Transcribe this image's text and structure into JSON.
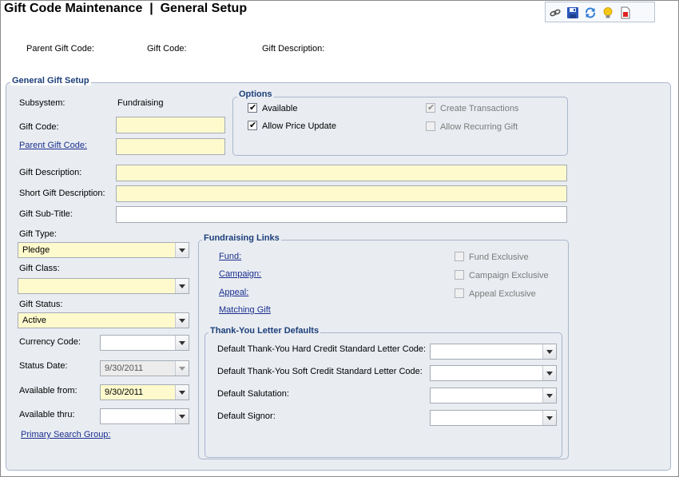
{
  "header": {
    "title": "Gift Code Maintenance  |  General Setup",
    "parent_gift_code_label": "Parent Gift Code:",
    "gift_code_label": "Gift Code:",
    "gift_description_label": "Gift Description:"
  },
  "toolbar": {
    "icons": [
      "link-icon",
      "save-icon",
      "refresh-icon",
      "lightbulb-icon",
      "report-icon"
    ]
  },
  "general": {
    "legend": "General Gift Setup",
    "subsystem_label": "Subsystem:",
    "subsystem_value": "Fundraising",
    "gift_code_label": "Gift Code:",
    "gift_code_value": "",
    "parent_gift_code_label": "Parent Gift Code:",
    "parent_gift_code_value": "",
    "gift_description_label": "Gift Description:",
    "gift_description_value": "",
    "short_gift_description_label": "Short Gift Description:",
    "short_gift_description_value": "",
    "gift_subtitle_label": "Gift Sub-Title:",
    "gift_subtitle_value": "",
    "gift_type_label": "Gift Type:",
    "gift_type_value": "Pledge",
    "gift_class_label": "Gift Class:",
    "gift_class_value": "",
    "gift_status_label": "Gift Status:",
    "gift_status_value": "Active",
    "currency_code_label": "Currency Code:",
    "currency_code_value": "",
    "status_date_label": "Status Date:",
    "status_date_value": "9/30/2011",
    "available_from_label": "Available from:",
    "available_from_value": "9/30/2011",
    "available_thru_label": "Available thru:",
    "available_thru_value": "",
    "primary_search_group_label": "Primary Search Group:"
  },
  "options": {
    "legend": "Options",
    "available": {
      "label": "Available",
      "checked": true,
      "enabled": true
    },
    "allow_price_update": {
      "label": "Allow Price Update",
      "checked": true,
      "enabled": true
    },
    "create_transactions": {
      "label": "Create Transactions",
      "checked": true,
      "enabled": false
    },
    "allow_recurring_gift": {
      "label": "Allow Recurring Gift",
      "checked": false,
      "enabled": false
    }
  },
  "fundraising_links": {
    "legend": "Fundraising Links",
    "fund_label": "Fund:",
    "campaign_label": "Campaign:",
    "appeal_label": "Appeal:",
    "matching_gift_label": "Matching Gift",
    "fund_exclusive": {
      "label": "Fund Exclusive",
      "checked": false
    },
    "campaign_exclusive": {
      "label": "Campaign Exclusive",
      "checked": false
    },
    "appeal_exclusive": {
      "label": "Appeal Exclusive",
      "checked": false
    }
  },
  "thank_you": {
    "legend": "Thank-You Letter Defaults",
    "hard_credit_label": "Default Thank-You Hard Credit Standard Letter Code:",
    "hard_credit_value": "",
    "soft_credit_label": "Default Thank-You Soft Credit Standard Letter Code:",
    "soft_credit_value": "",
    "salutation_label": "Default Salutation:",
    "salutation_value": "",
    "signor_label": "Default Signor:",
    "signor_value": ""
  },
  "colors": {
    "required_field": "#fffacd",
    "panel_bg": "#e9ecf1",
    "legend_text": "#1c3f7a",
    "link_text": "#1a2f8f"
  }
}
